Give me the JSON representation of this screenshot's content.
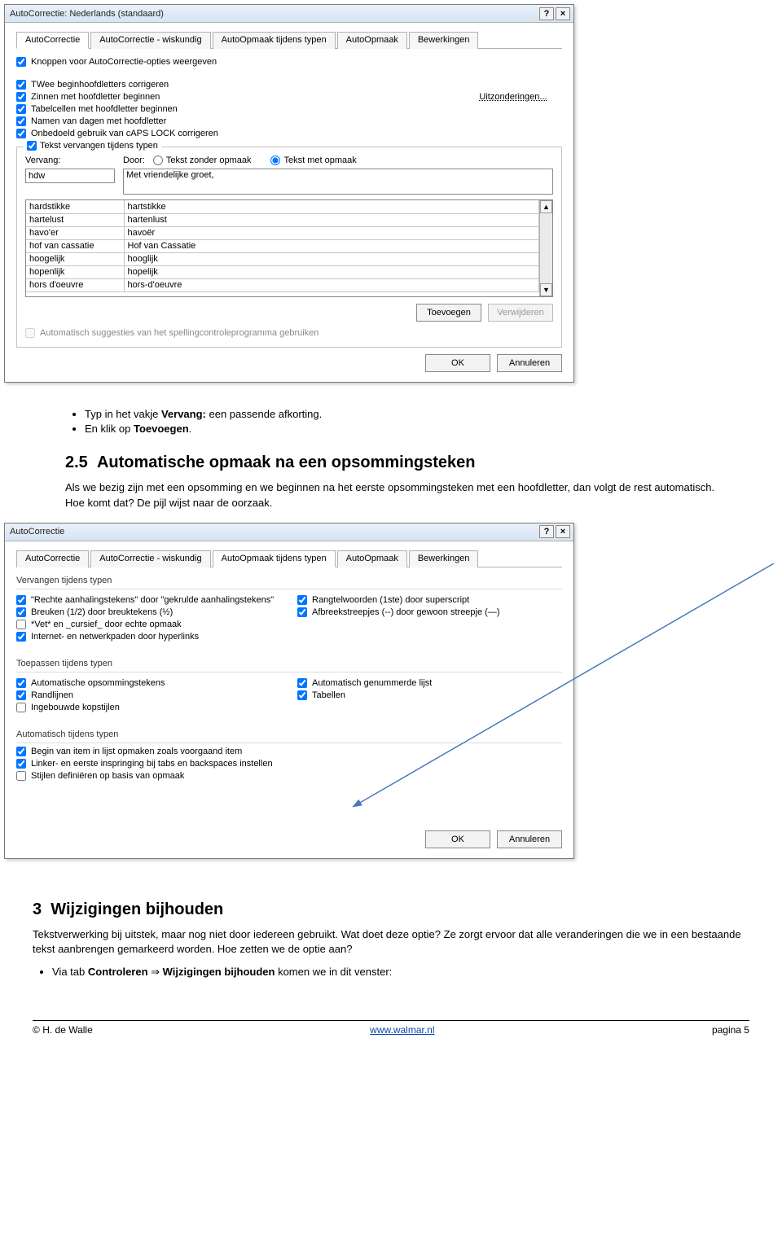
{
  "dialog1": {
    "title": "AutoCorrectie: Nederlands (standaard)",
    "help_label": "?",
    "close_label": "×",
    "tabs": [
      "AutoCorrectie",
      "AutoCorrectie - wiskundig",
      "AutoOpmaak tijdens typen",
      "AutoOpmaak",
      "Bewerkingen"
    ],
    "top_checks": [
      "Knoppen voor AutoCorrectie-opties weergeven",
      "TWee beginhoofdletters corrigeren",
      "Zinnen met hoofdletter beginnen",
      "Tabelcellen met hoofdletter beginnen",
      "Namen van dagen met hoofdletter",
      "Onbedoeld gebruik van cAPS LOCK corrigeren"
    ],
    "uitzonderingen_label": "Uitzonderingen...",
    "group_legend": "Tekst vervangen tijdens typen",
    "vervang_label": "Vervang:",
    "door_label": "Door:",
    "radio_plain": "Tekst zonder opmaak",
    "radio_fmt": "Tekst met opmaak",
    "vervang_value": "hdw",
    "door_value": "Met vriendelijke groet,",
    "table_rows": [
      [
        "hardstikke",
        "hartstikke"
      ],
      [
        "hartelust",
        "hartenlust"
      ],
      [
        "havo'er",
        "havoër"
      ],
      [
        "hof van cassatie",
        "Hof van Cassatie"
      ],
      [
        "hoogelijk",
        "hooglijk"
      ],
      [
        "hopenlijk",
        "hopelijk"
      ],
      [
        "hors d'oeuvre",
        "hors-d'oeuvre"
      ]
    ],
    "scroll_up": "▲",
    "scroll_down": "▼",
    "toevoegen_label": "Toevoegen",
    "verwijderen_label": "Verwijderen",
    "auto_suggest_label": "Automatisch suggesties van het spellingcontroleprogramma gebruiken",
    "ok_label": "OK",
    "cancel_label": "Annuleren"
  },
  "doc1": {
    "bullet1_a": "Typ in het vakje ",
    "bullet1_b": "Vervang:",
    "bullet1_c": " een passende afkorting.",
    "bullet2_a": "En klik op ",
    "bullet2_b": "Toevoegen",
    "bullet2_c": ".",
    "h_num": "2.5",
    "h_title": "Automatische opmaak na een opsommingsteken",
    "para": "Als we bezig zijn met een opsomming en we beginnen na het eerste opsommingsteken met een hoofdletter, dan volgt de rest automatisch. Hoe komt dat? De pijl wijst naar de oorzaak."
  },
  "dialog2": {
    "title": "AutoCorrectie",
    "help_label": "?",
    "close_label": "×",
    "tabs": [
      "AutoCorrectie",
      "AutoCorrectie - wiskundig",
      "AutoOpmaak tijdens typen",
      "AutoOpmaak",
      "Bewerkingen"
    ],
    "sec1_title": "Vervangen tijdens typen",
    "sec1_left": [
      "\"Rechte aanhalingstekens\" door \"gekrulde aanhalingstekens\"",
      "Breuken (1/2) door breuktekens (½)",
      "*Vet* en _cursief_ door echte opmaak",
      "Internet- en netwerkpaden door hyperlinks"
    ],
    "sec1_right": [
      "Rangtelwoorden (1ste) door superscript",
      "Afbreekstreepjes (--) door gewoon streepje (—)"
    ],
    "sec1_left_checked": [
      true,
      true,
      false,
      true
    ],
    "sec1_right_checked": [
      true,
      true
    ],
    "sec2_title": "Toepassen tijdens typen",
    "sec2_left": [
      "Automatische opsommingstekens",
      "Randlijnen",
      "Ingebouwde kopstijlen"
    ],
    "sec2_left_checked": [
      true,
      true,
      false
    ],
    "sec2_right": [
      "Automatisch genummerde lijst",
      "Tabellen"
    ],
    "sec2_right_checked": [
      true,
      true
    ],
    "sec3_title": "Automatisch tijdens typen",
    "sec3_items": [
      "Begin van item in lijst opmaken zoals voorgaand item",
      "Linker- en eerste inspringing bij tabs en backspaces instellen",
      "Stijlen definiëren op basis van opmaak"
    ],
    "sec3_checked": [
      true,
      true,
      false
    ],
    "ok_label": "OK",
    "cancel_label": "Annuleren"
  },
  "doc2": {
    "h_num": "3",
    "h_title": "Wijzigingen bijhouden",
    "para": "Tekstverwerking bij uitstek, maar nog niet door iedereen gebruikt. Wat doet deze optie? Ze zorgt ervoor dat alle veranderingen die we in een bestaande tekst aanbrengen gemarkeerd worden. Hoe zetten we de optie aan?",
    "bullet_a": "Via tab ",
    "bullet_b": "Controleren",
    "bullet_arrow": " ⇒ ",
    "bullet_c": "Wijzigingen bijhouden",
    "bullet_d": " komen we in dit venster:"
  },
  "footer": {
    "left_prefix": "© ",
    "left": "H. de Walle",
    "link": "www.walmar.nl",
    "right": "pagina 5"
  }
}
